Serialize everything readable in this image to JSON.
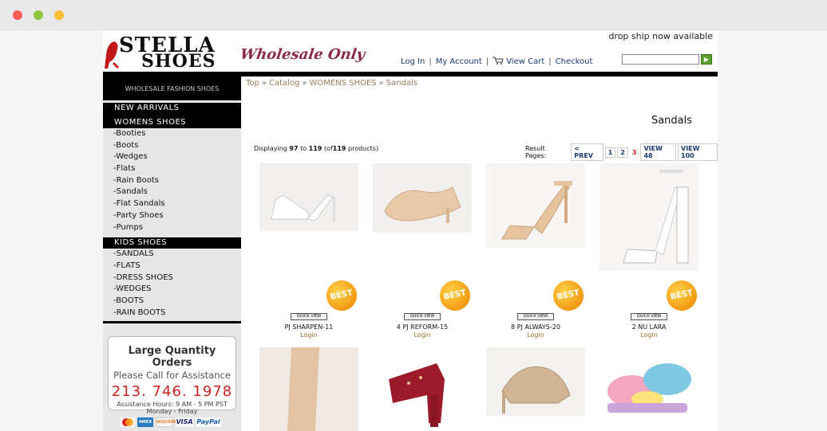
{
  "header": {
    "logo_line1": "STELLA",
    "logo_line2": "SHOES",
    "tagline": "Wholesale Only",
    "dropship": "drop ship now available",
    "nav": {
      "login": "Log In",
      "account": "My Account",
      "cart": "View Cart",
      "checkout": "Checkout",
      "sep": "|"
    },
    "search": {
      "value": "",
      "button": "▶"
    }
  },
  "sidebar": {
    "heading": "WHOLESALE FASHION SHOES",
    "new_arrivals": "NEW ARRIVALS",
    "womens": {
      "title": "WOMENS SHOES",
      "items": [
        "-Booties",
        "-Boots",
        "-Wedges",
        "-Flats",
        "-Rain Boots",
        "-Sandals",
        "-Flat Sandals",
        "-Party Shoes",
        "-Pumps"
      ]
    },
    "kids": {
      "title": "KIDS SHOES",
      "items": [
        "-SANDALS",
        "-FLATS",
        "-DRESS SHOES",
        "-WEDGES",
        "-BOOTS",
        "-RAIN BOOTS"
      ]
    },
    "promo": {
      "line1": "Large Quantity Orders",
      "line2": "Please Call for Assistance",
      "phone": "213. 746. 1978",
      "hours": "Assistance Hours: 9 AM - 5 PM PST",
      "days": "Monday - Friday"
    },
    "cards": [
      "MasterCard",
      "AMEX",
      "DISCOVER",
      "VISA",
      "PayPal"
    ]
  },
  "main": {
    "breadcrumb": [
      "Top",
      "Catalog",
      "WOMENS SHOES",
      "Sandals"
    ],
    "breadcrumb_sep": "»",
    "title": "Sandals",
    "displaying": {
      "prefix": "Displaying",
      "from": "97",
      "to_word": "to",
      "to": "119",
      "of_prefix": "(of",
      "total": "119",
      "suffix": "products)"
    },
    "pager": {
      "label": "Result Pages:",
      "prev": "< PREV",
      "pages": [
        "1",
        "2",
        "3"
      ],
      "current": "3",
      "view48": "VIEW 48",
      "view100": "VIEW 100"
    },
    "badge": "BEST",
    "quick_view": "QUICK VIEW",
    "products": [
      {
        "name": "PJ SHARPEN-11",
        "login": "Login"
      },
      {
        "name": "4 PJ REFORM-15",
        "login": "Login"
      },
      {
        "name": "8 PJ ALWAYS-20",
        "login": "Login"
      },
      {
        "name": "2 NU LARA",
        "login": "Login"
      }
    ]
  }
}
